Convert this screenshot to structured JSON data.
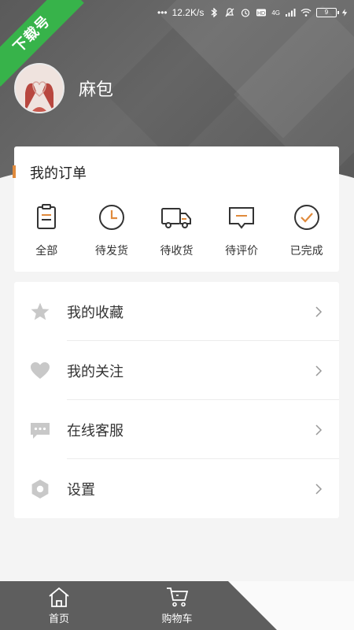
{
  "status_bar": {
    "speed": "12.2K/s",
    "net_label": "4G",
    "battery": "9"
  },
  "ribbon": {
    "text": "下载号"
  },
  "profile": {
    "username": "麻包"
  },
  "orders": {
    "title": "我的订单",
    "items": [
      {
        "label": "全部",
        "icon": "clipboard-icon"
      },
      {
        "label": "待发货",
        "icon": "clock-icon"
      },
      {
        "label": "待收货",
        "icon": "truck-icon"
      },
      {
        "label": "待评价",
        "icon": "comment-icon"
      },
      {
        "label": "已完成",
        "icon": "check-circle-icon"
      }
    ]
  },
  "menu": {
    "items": [
      {
        "label": "我的收藏",
        "icon": "star-icon"
      },
      {
        "label": "我的关注",
        "icon": "heart-icon"
      },
      {
        "label": "在线客服",
        "icon": "chat-icon"
      },
      {
        "label": "设置",
        "icon": "settings-hexagon-icon"
      }
    ]
  },
  "bottom_nav": {
    "items": [
      {
        "label": "首页",
        "icon": "home-icon"
      },
      {
        "label": "购物车",
        "icon": "cart-icon"
      }
    ]
  },
  "colors": {
    "accent": "#e08a3c",
    "header": "#5e5e5e",
    "ribbon": "#37b34a",
    "icon_gray": "#c8c8c8"
  }
}
